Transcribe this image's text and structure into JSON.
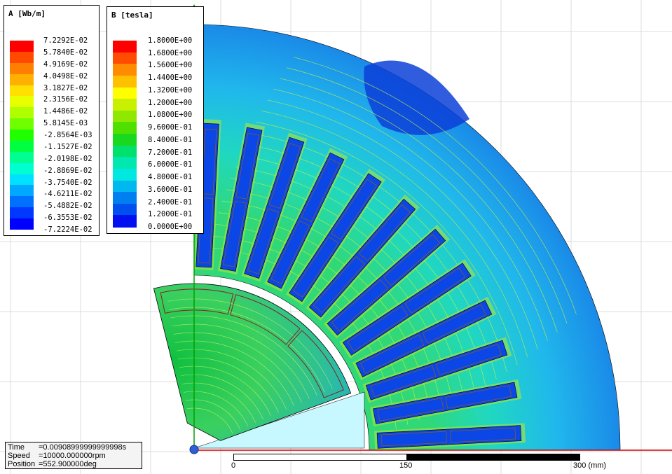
{
  "legend_a": {
    "title": "A [Wb/m]",
    "labels": [
      "7.2292E-02",
      "5.7840E-02",
      "4.9169E-02",
      "4.0498E-02",
      "3.1827E-02",
      "2.3156E-02",
      "1.4486E-02",
      "5.8145E-03",
      "-2.8564E-03",
      "-1.1527E-02",
      "-2.0198E-02",
      "-2.8869E-02",
      "-3.7540E-02",
      "-4.6211E-02",
      "-5.4882E-02",
      "-6.3553E-02",
      "-7.2224E-02"
    ],
    "colors": [
      "#ff0000",
      "#ff4a00",
      "#ff8000",
      "#ffb000",
      "#ffe000",
      "#e8ff00",
      "#b0ff00",
      "#70ff00",
      "#20ff00",
      "#00ff40",
      "#00ff90",
      "#00ffd0",
      "#00e0ff",
      "#00a8ff",
      "#0070ff",
      "#0038ff",
      "#0000ff"
    ]
  },
  "legend_b": {
    "title": "B [tesla]",
    "labels": [
      "1.8000E+00",
      "1.6800E+00",
      "1.5600E+00",
      "1.4400E+00",
      "1.3200E+00",
      "1.2000E+00",
      "1.0800E+00",
      "9.6000E-01",
      "8.4000E-01",
      "7.2000E-01",
      "6.0000E-01",
      "4.8000E-01",
      "3.6000E-01",
      "2.4000E-01",
      "1.2000E-01",
      "0.0000E+00"
    ],
    "colors": [
      "#ff0000",
      "#ff4c00",
      "#ff8c00",
      "#ffc000",
      "#ffff00",
      "#c8f000",
      "#90e800",
      "#50e000",
      "#18d820",
      "#00e06c",
      "#00e8b0",
      "#00e8e0",
      "#00b8f0",
      "#0080f0",
      "#0050f0",
      "#0010f0"
    ]
  },
  "status": {
    "time_key": "Time",
    "time_val": "=0.00908999999999998s",
    "speed_key": "Speed",
    "speed_val": "=10000.000000rpm",
    "position_key": "Position",
    "position_val": "=552.900000deg"
  },
  "scale": {
    "label_0": "0",
    "label_150": "150",
    "label_300": "300 (mm)"
  },
  "axis": {
    "y_label": "Y"
  },
  "model": {
    "stator_slots": 12,
    "rotor_poles_visible": 3
  },
  "colors": {
    "background": "#ffffff",
    "grid": "#d8d8d8",
    "stator_back": "#1a78e6",
    "stator_yoke": "#29c3f0",
    "teeth": "#22cc6a",
    "slot_coil": "#0b46e6",
    "rotor": "#40d060",
    "airgap_region": "#c8f8ff",
    "x_axis": "#d00000",
    "y_axis": "#00a000",
    "coil_outline": "#8a5a2a"
  }
}
